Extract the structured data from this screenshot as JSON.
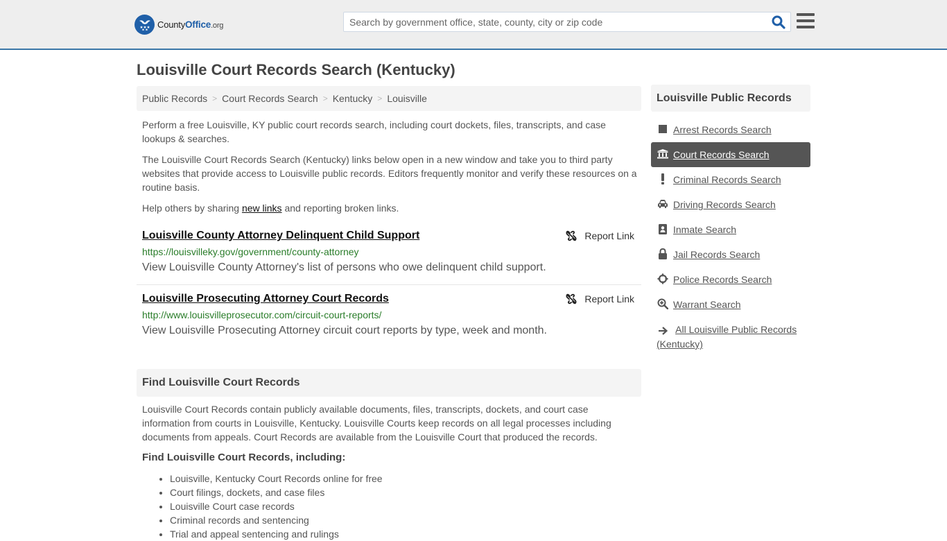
{
  "header": {
    "logo": {
      "brand_main": "County",
      "brand_accent": "Office",
      "brand_tld": ".org"
    },
    "search": {
      "placeholder": "Search by government office, state, county, city or zip code",
      "value": ""
    },
    "colors": {
      "brand_blue": "#1f5fa8",
      "header_border": "#3b77a8",
      "header_bg": "#eeeeee"
    }
  },
  "page": {
    "title": "Louisville Court Records Search (Kentucky)"
  },
  "breadcrumb": [
    {
      "label": "Public Records"
    },
    {
      "label": "Court Records Search"
    },
    {
      "label": "Kentucky"
    },
    {
      "label": "Louisville"
    }
  ],
  "breadcrumb_separator": ">",
  "intro": {
    "p1": "Perform a free Louisville, KY public court records search, including court dockets, files, transcripts, and case lookups & searches.",
    "p2": "The Louisville Court Records Search (Kentucky) links below open in a new window and take you to third party websites that provide access to Louisville public records. Editors frequently monitor and verify these resources on a routine basis.",
    "p3_before": "Help others by sharing ",
    "p3_link": "new links",
    "p3_after": " and reporting broken links."
  },
  "results": [
    {
      "title": "Louisville County Attorney Delinquent Child Support",
      "url": "https://louisvilleky.gov/government/county-attorney",
      "description": "View Louisville County Attorney's list of persons who owe delinquent child support.",
      "report_label": "Report Link"
    },
    {
      "title": "Louisville Prosecuting Attorney Court Records",
      "url": "http://www.louisvilleprosecutor.com/circuit-court-reports/",
      "description": "View Louisville Prosecuting Attorney circuit court reports by type, week and month.",
      "report_label": "Report Link"
    }
  ],
  "find_section": {
    "header": "Find Louisville Court Records",
    "body": "Louisville Court Records contain publicly available documents, files, transcripts, dockets, and court case information from courts in Louisville, Kentucky. Louisville Courts keep records on all legal processes including documents from appeals. Court Records are available from the Louisville Court that produced the records.",
    "subhead": "Find Louisville Court Records, including:",
    "bullets": [
      "Louisville, Kentucky Court Records online for free",
      "Court filings, dockets, and case files",
      "Louisville Court case records",
      "Criminal records and sentencing",
      "Trial and appeal sentencing and rulings"
    ]
  },
  "sidebar": {
    "title": "Louisville Public Records",
    "items": [
      {
        "label": "Arrest Records Search",
        "icon": "square-icon",
        "active": false
      },
      {
        "label": "Court Records Search",
        "icon": "courthouse-icon",
        "active": true
      },
      {
        "label": "Criminal Records Search",
        "icon": "exclamation-icon",
        "active": false
      },
      {
        "label": "Driving Records Search",
        "icon": "car-icon",
        "active": false
      },
      {
        "label": "Inmate Search",
        "icon": "id-badge-icon",
        "active": false
      },
      {
        "label": "Jail Records Search",
        "icon": "lock-icon",
        "active": false
      },
      {
        "label": "Police Records Search",
        "icon": "crosshairs-icon",
        "active": false
      },
      {
        "label": "Warrant Search",
        "icon": "search-plus-icon",
        "active": false
      },
      {
        "label": "All Louisville Public Records (Kentucky)",
        "icon": "arrow-right-icon",
        "active": false
      }
    ]
  }
}
